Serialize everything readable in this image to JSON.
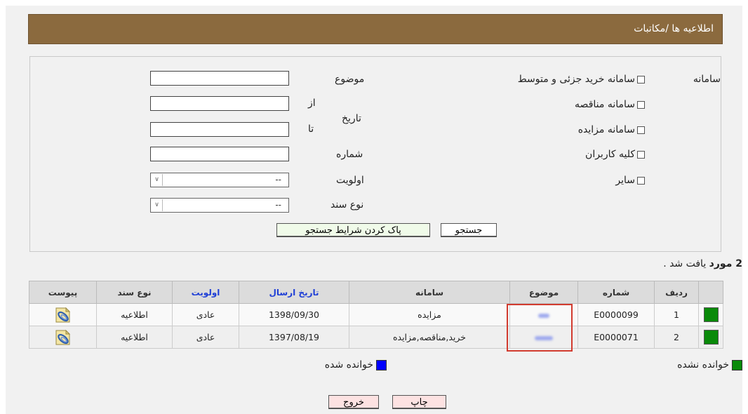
{
  "header": {
    "title": "اطلاعیه ها /مکاتبات"
  },
  "search": {
    "system_label": "سامانه",
    "systems": [
      "سامانه خرید جزئی و متوسط",
      "سامانه مناقصه",
      "سامانه مزایده",
      "کلیه کاربران",
      "سایر"
    ],
    "subject_label": "موضوع",
    "subject_value": "",
    "date_label": "تاریخ",
    "from_label": "از",
    "to_label": "تا",
    "from_value": "",
    "to_value": "",
    "number_label": "شماره",
    "number_value": "",
    "priority_label": "اولویت",
    "priority_value": "--",
    "doc_type_label": "نوع سند",
    "doc_type_value": "--",
    "search_button": "جستجو",
    "clear_button": "پاک کردن شرایط جستجو"
  },
  "results": {
    "count": "2 مورد",
    "found_suffix": "یافت شد .",
    "columns": [
      "ردیف",
      "شماره",
      "موضوع",
      "سامانه",
      "تاریخ ارسال",
      "اولویت",
      "نوع سند",
      "پیوست"
    ],
    "rows": [
      {
        "index": "1",
        "number": "E0000099",
        "system": "مزایده",
        "date": "1398/09/30",
        "priority": "عادی",
        "doc_type": "اطلاعیه"
      },
      {
        "index": "2",
        "number": "E0000071",
        "system": "خرید,مناقصه,مزایده",
        "date": "1397/08/19",
        "priority": "عادی",
        "doc_type": "اطلاعیه"
      }
    ]
  },
  "legend": {
    "unread": "خوانده نشده",
    "read": "خوانده شده"
  },
  "footer": {
    "print_button": "چاپ",
    "exit_button": "خروج"
  },
  "colors": {
    "header_bg": "#8b6a3e",
    "unread": "#0a8a0a",
    "read": "#0000ff",
    "highlight": "#d23b2f"
  }
}
